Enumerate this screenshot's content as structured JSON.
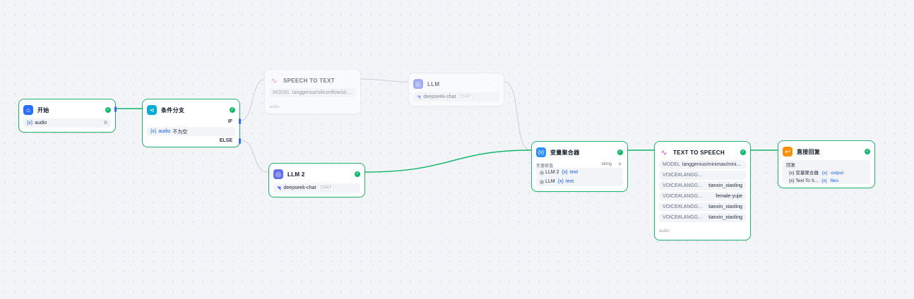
{
  "nodes": {
    "start": {
      "title": "开始",
      "var_icon": "{x}",
      "var": "audio"
    },
    "branch": {
      "title": "条件分支",
      "if_label": "IF",
      "cond_icon": "{x}",
      "cond_var": "audio",
      "cond_op": "不为空",
      "else_label": "ELSE"
    },
    "stt": {
      "title": "SPEECH TO TEXT",
      "model_label": "MODEL",
      "model": "langgenius/siliconflow/sil...",
      "output": "audio"
    },
    "llm": {
      "title": "LLM",
      "model": "deepseek-chat",
      "mode": "CHAT"
    },
    "llm2": {
      "title": "LLM 2",
      "model": "deepseek-chat",
      "mode": "CHAT"
    },
    "aggregator": {
      "title": "变量聚合器",
      "group_label": "变量赋值",
      "type": "string",
      "add": "+",
      "items": [
        {
          "source": "LLM 2",
          "var_icon": "{x}",
          "var": "text"
        },
        {
          "source": "LLM",
          "var_icon": "{x}",
          "var": "text"
        }
      ]
    },
    "tts": {
      "title": "TEXT TO SPEECH",
      "model_label": "MODEL",
      "model": "langgenius/minimax/mini...",
      "voices": [
        {
          "label": "VOICE#LANGG...",
          "value": ""
        },
        {
          "label": "VOICE#LANGG...",
          "value": "tianxin_xiaoling"
        },
        {
          "label": "VOICE#LANGG...",
          "value": "female-yujie"
        },
        {
          "label": "VOICE#LANGG...",
          "value": "tianxin_xiaoling"
        },
        {
          "label": "VOICE#LANGG...",
          "value": "tianxin_xiaoling"
        }
      ],
      "output": "audio"
    },
    "reply": {
      "title": "直接回复",
      "reply_label": "回复",
      "lines": [
        {
          "src_icon": "{x}",
          "src": "变量聚合器",
          "var_icon": "{x}",
          "var": "output"
        },
        {
          "src_icon": "{x}",
          "src": "Text To S...",
          "var_icon": "{x}",
          "var": "files"
        }
      ]
    }
  },
  "colors": {
    "start": "#2970ff",
    "branch": "#06aed4",
    "llm": "#6172f3",
    "aggregator": "#2e90fa",
    "speech": "#ee46bc",
    "reply": "#f79009",
    "success": "#12b76a",
    "edge_active": "#12b76a",
    "edge_idle": "#d0d5dd"
  },
  "icons": {
    "start": "home-icon",
    "branch": "branch-icon",
    "stt": "speech-wave-icon",
    "llm": "brain-icon",
    "aggregator": "variable-icon",
    "tts": "speech-wave-icon",
    "reply": "reply-icon",
    "model": "deepseek-whale-icon",
    "copy": "copy-icon",
    "status": "check-circle-icon"
  }
}
